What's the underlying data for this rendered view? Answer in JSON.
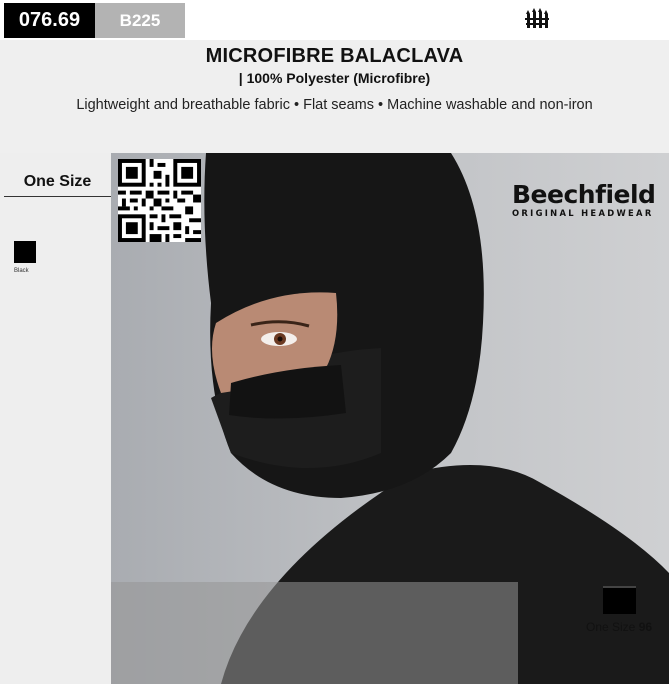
{
  "header": {
    "price_code": "076.69",
    "sku": "B225",
    "brand_icon": "beechfield-crown-icon"
  },
  "product": {
    "title": "MICROFIBRE BALACLAVA",
    "material": "| 100% Polyester (Microfibre)",
    "features": "Lightweight and breathable fabric • Flat seams • Machine washable and non-iron"
  },
  "sidebar": {
    "size_heading": "One Size",
    "colours": [
      {
        "name": "Black",
        "hex": "#000000"
      }
    ]
  },
  "brand_logo": {
    "name": "Beechfield",
    "tagline": "ORIGINAL HEADWEAR"
  },
  "sample": {
    "size": "One Size",
    "quantity": "96"
  },
  "colors": {
    "price_bg": "#000000",
    "sku_bg": "#b3b3b3",
    "header_band": "#efefef",
    "sidebar_bg": "#eeeeee"
  }
}
